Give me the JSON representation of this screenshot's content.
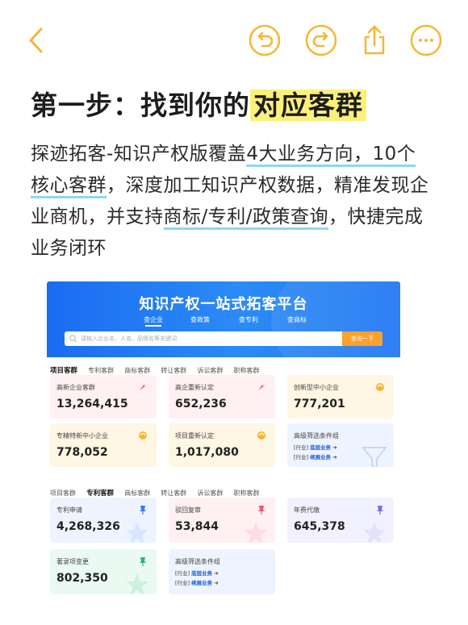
{
  "toolbar": {
    "back_icon": "chevron-left-icon",
    "undo_icon": "undo-icon",
    "redo_icon": "redo-icon",
    "share_icon": "share-icon",
    "more_icon": "more-icon",
    "accent": "#f5b731"
  },
  "headline": {
    "part1": "第一步：找到你的",
    "highlight": "对应客群"
  },
  "paragraph": {
    "s1": "探迹拓客-知识产权版覆盖",
    "u1": "4大业务方向，10个核心客群",
    "s2": "，深度加工知识产权数据，精准发现企业商机，并支持",
    "u2": "商标/专利/政策查询",
    "s3": "，快捷完成业务闭环"
  },
  "screenshot": {
    "title": "知识产权一站式拓客平台",
    "tabs": [
      "查企业",
      "查政策",
      "查专利",
      "查商标"
    ],
    "search_placeholder": "请输入企业名、人名、品牌名等关键词",
    "search_button": "查询一下",
    "group1": {
      "subtabs": [
        "项目客群",
        "专利客群",
        "商标客群",
        "转让客群",
        "诉讼客群",
        "职称客群"
      ],
      "active": 0,
      "cards": [
        {
          "label": "高新企业客群",
          "value": "13,264,415"
        },
        {
          "label": "高企重新认定",
          "value": "652,236"
        },
        {
          "label": "创新型中小企业",
          "value": "777,201"
        },
        {
          "label": "专精特新中小企业",
          "value": "778,052"
        },
        {
          "label": "项目重新认定",
          "value": "1,017,080"
        }
      ],
      "advanced": {
        "label": "高级筛选条件组",
        "line1_tag": "[行业]",
        "line1_text": "底层业务",
        "line2_tag": "[行业]",
        "line2_text": "续展业务"
      }
    },
    "group2": {
      "subtabs": [
        "项目客群",
        "专利客群",
        "商标客群",
        "转让客群",
        "诉讼客群",
        "职称客群"
      ],
      "active": 1,
      "cards": [
        {
          "label": "专利申请",
          "value": "4,268,326"
        },
        {
          "label": "驳回复审",
          "value": "53,844"
        },
        {
          "label": "年费代缴",
          "value": "645,378"
        },
        {
          "label": "著录项变更",
          "value": "802,350"
        }
      ],
      "advanced": {
        "label": "高级筛选条件组",
        "line1_tag": "[行业]",
        "line1_text": "底层业务",
        "line2_tag": "[行业]",
        "line2_text": "续展业务"
      }
    }
  }
}
